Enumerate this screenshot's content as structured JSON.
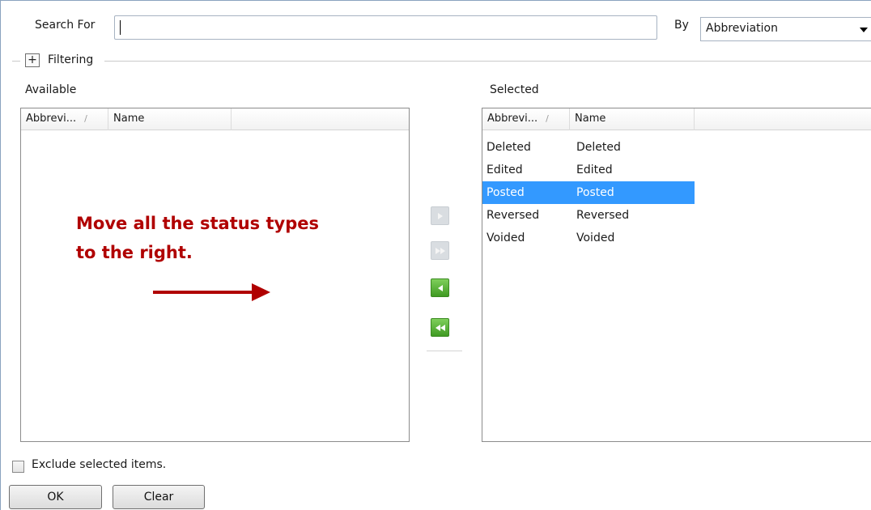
{
  "search": {
    "label": "Search For",
    "value": "",
    "by_label": "By",
    "by_value": "Abbreviation"
  },
  "filtering": {
    "expand_glyph": "+",
    "label": "Filtering"
  },
  "available": {
    "title": "Available",
    "columns": [
      "Abbrevi...",
      "Name"
    ],
    "sort_glyph": "/",
    "rows": []
  },
  "selected": {
    "title": "Selected",
    "columns": [
      "Abbrevi...",
      "Name"
    ],
    "sort_glyph": "/",
    "rows": [
      {
        "abbreviation": "Deleted",
        "name": "Deleted",
        "selected": false
      },
      {
        "abbreviation": "Edited",
        "name": "Edited",
        "selected": false
      },
      {
        "abbreviation": "Posted",
        "name": "Posted",
        "selected": true
      },
      {
        "abbreviation": "Reversed",
        "name": "Reversed",
        "selected": false
      },
      {
        "abbreviation": "Voided",
        "name": "Voided",
        "selected": false
      }
    ]
  },
  "move_buttons": {
    "move_right": "move-right-icon",
    "move_all_right": "move-all-right-icon",
    "move_left": "move-left-icon",
    "move_all_left": "move-all-left-icon"
  },
  "annotation": {
    "text": "Move all the status types\nto the right.",
    "color": "#b00000"
  },
  "options": {
    "exclude_label": "Exclude selected items.",
    "exclude_checked": false
  },
  "buttons": {
    "ok_label": "OK",
    "clear_label": "Clear"
  },
  "colors": {
    "selection": "#3399ff",
    "move_enabled": "#4caf2a",
    "move_disabled": "#d9dde1"
  }
}
